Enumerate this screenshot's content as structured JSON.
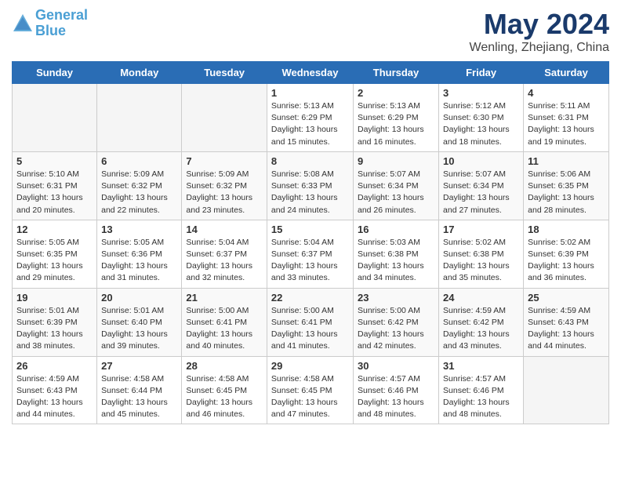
{
  "logo": {
    "line1": "General",
    "line2": "Blue"
  },
  "title": "May 2024",
  "location": "Wenling, Zhejiang, China",
  "days_header": [
    "Sunday",
    "Monday",
    "Tuesday",
    "Wednesday",
    "Thursday",
    "Friday",
    "Saturday"
  ],
  "weeks": [
    [
      {
        "num": "",
        "info": ""
      },
      {
        "num": "",
        "info": ""
      },
      {
        "num": "",
        "info": ""
      },
      {
        "num": "1",
        "info": "Sunrise: 5:13 AM\nSunset: 6:29 PM\nDaylight: 13 hours and 15 minutes."
      },
      {
        "num": "2",
        "info": "Sunrise: 5:13 AM\nSunset: 6:29 PM\nDaylight: 13 hours and 16 minutes."
      },
      {
        "num": "3",
        "info": "Sunrise: 5:12 AM\nSunset: 6:30 PM\nDaylight: 13 hours and 18 minutes."
      },
      {
        "num": "4",
        "info": "Sunrise: 5:11 AM\nSunset: 6:31 PM\nDaylight: 13 hours and 19 minutes."
      }
    ],
    [
      {
        "num": "5",
        "info": "Sunrise: 5:10 AM\nSunset: 6:31 PM\nDaylight: 13 hours and 20 minutes."
      },
      {
        "num": "6",
        "info": "Sunrise: 5:09 AM\nSunset: 6:32 PM\nDaylight: 13 hours and 22 minutes."
      },
      {
        "num": "7",
        "info": "Sunrise: 5:09 AM\nSunset: 6:32 PM\nDaylight: 13 hours and 23 minutes."
      },
      {
        "num": "8",
        "info": "Sunrise: 5:08 AM\nSunset: 6:33 PM\nDaylight: 13 hours and 24 minutes."
      },
      {
        "num": "9",
        "info": "Sunrise: 5:07 AM\nSunset: 6:34 PM\nDaylight: 13 hours and 26 minutes."
      },
      {
        "num": "10",
        "info": "Sunrise: 5:07 AM\nSunset: 6:34 PM\nDaylight: 13 hours and 27 minutes."
      },
      {
        "num": "11",
        "info": "Sunrise: 5:06 AM\nSunset: 6:35 PM\nDaylight: 13 hours and 28 minutes."
      }
    ],
    [
      {
        "num": "12",
        "info": "Sunrise: 5:05 AM\nSunset: 6:35 PM\nDaylight: 13 hours and 29 minutes."
      },
      {
        "num": "13",
        "info": "Sunrise: 5:05 AM\nSunset: 6:36 PM\nDaylight: 13 hours and 31 minutes."
      },
      {
        "num": "14",
        "info": "Sunrise: 5:04 AM\nSunset: 6:37 PM\nDaylight: 13 hours and 32 minutes."
      },
      {
        "num": "15",
        "info": "Sunrise: 5:04 AM\nSunset: 6:37 PM\nDaylight: 13 hours and 33 minutes."
      },
      {
        "num": "16",
        "info": "Sunrise: 5:03 AM\nSunset: 6:38 PM\nDaylight: 13 hours and 34 minutes."
      },
      {
        "num": "17",
        "info": "Sunrise: 5:02 AM\nSunset: 6:38 PM\nDaylight: 13 hours and 35 minutes."
      },
      {
        "num": "18",
        "info": "Sunrise: 5:02 AM\nSunset: 6:39 PM\nDaylight: 13 hours and 36 minutes."
      }
    ],
    [
      {
        "num": "19",
        "info": "Sunrise: 5:01 AM\nSunset: 6:39 PM\nDaylight: 13 hours and 38 minutes."
      },
      {
        "num": "20",
        "info": "Sunrise: 5:01 AM\nSunset: 6:40 PM\nDaylight: 13 hours and 39 minutes."
      },
      {
        "num": "21",
        "info": "Sunrise: 5:00 AM\nSunset: 6:41 PM\nDaylight: 13 hours and 40 minutes."
      },
      {
        "num": "22",
        "info": "Sunrise: 5:00 AM\nSunset: 6:41 PM\nDaylight: 13 hours and 41 minutes."
      },
      {
        "num": "23",
        "info": "Sunrise: 5:00 AM\nSunset: 6:42 PM\nDaylight: 13 hours and 42 minutes."
      },
      {
        "num": "24",
        "info": "Sunrise: 4:59 AM\nSunset: 6:42 PM\nDaylight: 13 hours and 43 minutes."
      },
      {
        "num": "25",
        "info": "Sunrise: 4:59 AM\nSunset: 6:43 PM\nDaylight: 13 hours and 44 minutes."
      }
    ],
    [
      {
        "num": "26",
        "info": "Sunrise: 4:59 AM\nSunset: 6:43 PM\nDaylight: 13 hours and 44 minutes."
      },
      {
        "num": "27",
        "info": "Sunrise: 4:58 AM\nSunset: 6:44 PM\nDaylight: 13 hours and 45 minutes."
      },
      {
        "num": "28",
        "info": "Sunrise: 4:58 AM\nSunset: 6:45 PM\nDaylight: 13 hours and 46 minutes."
      },
      {
        "num": "29",
        "info": "Sunrise: 4:58 AM\nSunset: 6:45 PM\nDaylight: 13 hours and 47 minutes."
      },
      {
        "num": "30",
        "info": "Sunrise: 4:57 AM\nSunset: 6:46 PM\nDaylight: 13 hours and 48 minutes."
      },
      {
        "num": "31",
        "info": "Sunrise: 4:57 AM\nSunset: 6:46 PM\nDaylight: 13 hours and 48 minutes."
      },
      {
        "num": "",
        "info": ""
      }
    ]
  ]
}
